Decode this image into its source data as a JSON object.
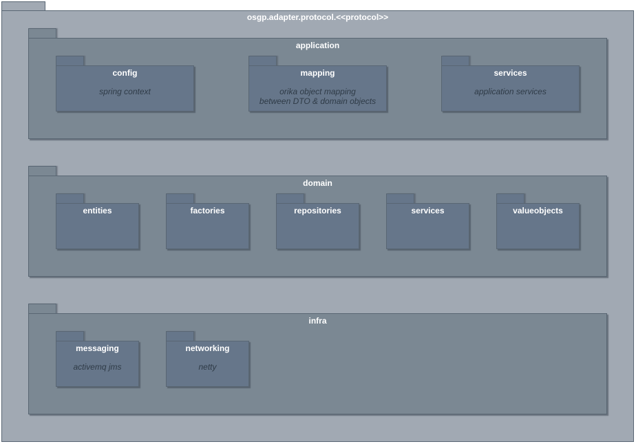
{
  "root": {
    "title": "osgp.adapter.protocol.<<protocol>>"
  },
  "application": {
    "title": "application",
    "config": {
      "title": "config",
      "desc": "spring context"
    },
    "mapping": {
      "title": "mapping",
      "desc_line1": "orika object mapping",
      "desc_line2": "between DTO & domain objects"
    },
    "services": {
      "title": "services",
      "desc": "application services"
    }
  },
  "domain": {
    "title": "domain",
    "entities": {
      "title": "entities"
    },
    "factories": {
      "title": "factories"
    },
    "repositories": {
      "title": "repositories"
    },
    "services": {
      "title": "services"
    },
    "valueobjects": {
      "title": "valueobjects"
    }
  },
  "infra": {
    "title": "infra",
    "messaging": {
      "title": "messaging",
      "desc": "activemq jms"
    },
    "networking": {
      "title": "networking",
      "desc": "netty"
    }
  },
  "colors": {
    "outer_fill": "#a1a9b3",
    "layer_fill": "#7b8893",
    "module_fill": "#66768a",
    "border": "#596673",
    "title_text": "#ffffff",
    "desc_text": "#2f3b47"
  }
}
